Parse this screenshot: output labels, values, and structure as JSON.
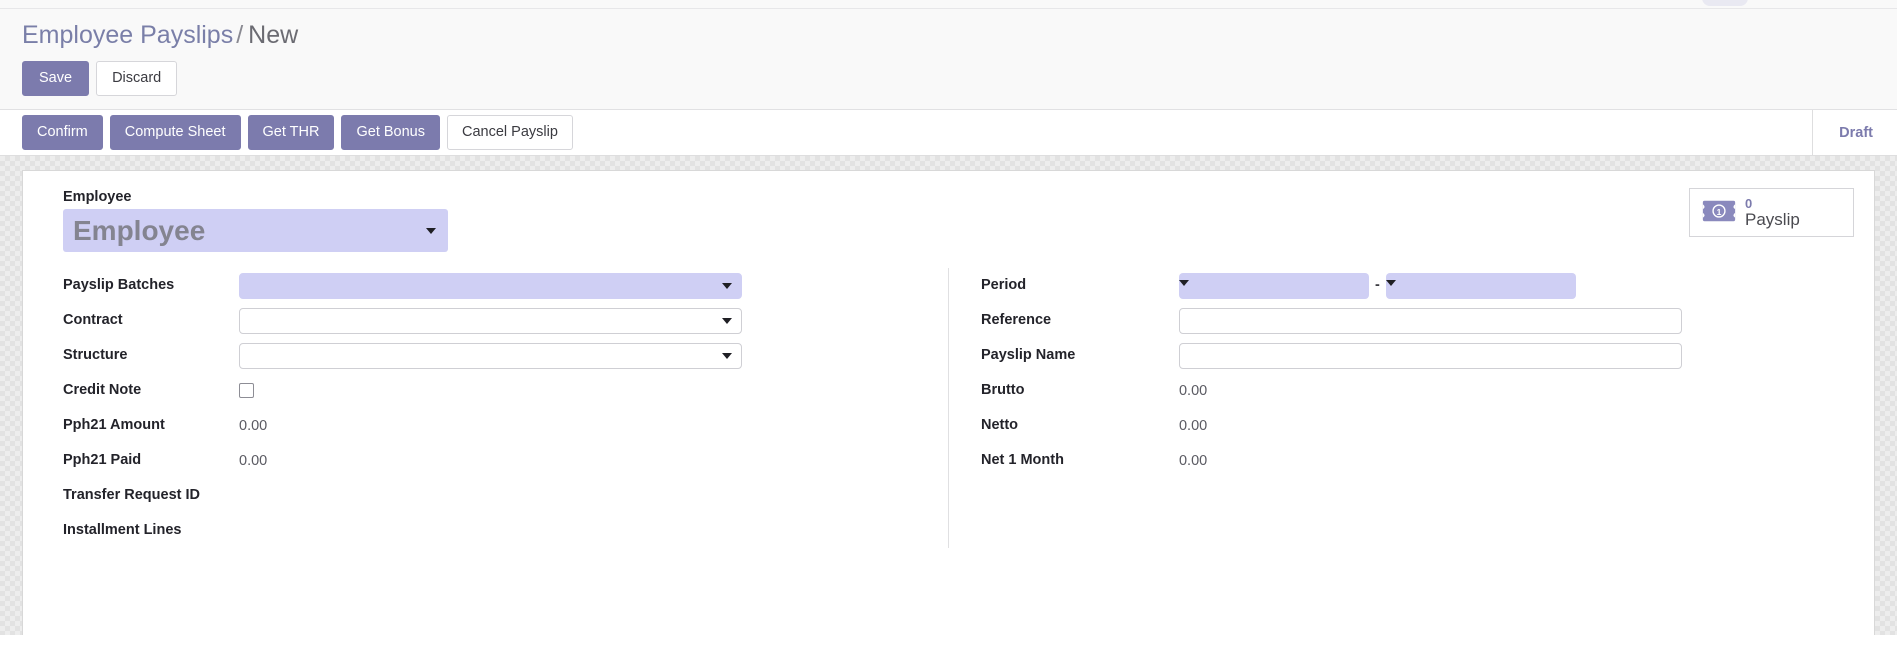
{
  "breadcrumb": {
    "parent": "Employee Payslips",
    "separator": "/",
    "current": "New"
  },
  "control_panel": {
    "save_label": "Save",
    "discard_label": "Discard"
  },
  "statusbar": {
    "actions": [
      {
        "label": "Confirm",
        "style": "primary"
      },
      {
        "label": "Compute Sheet",
        "style": "primary"
      },
      {
        "label": "Get THR",
        "style": "primary"
      },
      {
        "label": "Get Bonus",
        "style": "primary"
      },
      {
        "label": "Cancel Payslip",
        "style": "secondary"
      }
    ],
    "status": "Draft"
  },
  "smart_button": {
    "icon": "money-bill-icon",
    "value": "0",
    "label": "Payslip"
  },
  "employee_field": {
    "label": "Employee",
    "placeholder": "Employee",
    "value": "",
    "icon": "chevron-down-icon"
  },
  "form": {
    "left": [
      {
        "label": "Payslip Batches",
        "type": "select",
        "value": "",
        "required": true
      },
      {
        "label": "Contract",
        "type": "select",
        "value": "",
        "required": false
      },
      {
        "label": "Structure",
        "type": "select",
        "value": "",
        "required": false
      },
      {
        "label": "Credit Note",
        "type": "checkbox",
        "checked": false
      },
      {
        "label": "Pph21 Amount",
        "type": "readonly",
        "value": "0.00"
      },
      {
        "label": "Pph21 Paid",
        "type": "readonly",
        "value": "0.00"
      },
      {
        "label": "Transfer Request ID",
        "type": "readonly",
        "value": ""
      },
      {
        "label": "Installment Lines",
        "type": "readonly",
        "value": ""
      }
    ],
    "right": [
      {
        "label": "Period",
        "type": "period",
        "value_from": "",
        "value_to": "",
        "dash": "-",
        "required": true
      },
      {
        "label": "Reference",
        "type": "input",
        "value": "",
        "required": false
      },
      {
        "label": "Payslip Name",
        "type": "input",
        "value": "",
        "required": false
      },
      {
        "label": "Brutto",
        "type": "readonly",
        "value": "0.00"
      },
      {
        "label": "Netto",
        "type": "readonly",
        "value": "0.00"
      },
      {
        "label": "Net 1 Month",
        "type": "readonly",
        "value": "0.00"
      }
    ]
  },
  "colors": {
    "accent": "#7c7bad",
    "required_field": "#cfcff4",
    "status": "#7c7bad"
  }
}
